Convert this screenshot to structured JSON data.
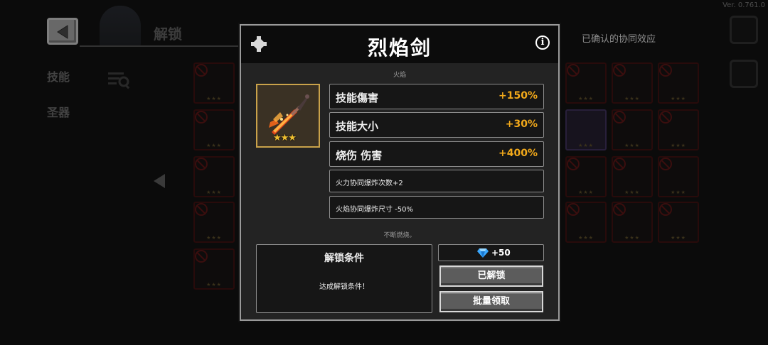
{
  "version": "Ver. 0.761.0",
  "screen": {
    "title": "解锁",
    "side_tabs": [
      "技能",
      "圣器"
    ],
    "synergy_label": "已确认的协同效应"
  },
  "modal": {
    "title": "烈焰剑",
    "subtitle": "火焰",
    "item_stars": "★★★",
    "stats": [
      {
        "name": "技能傷害",
        "value": "+150%"
      },
      {
        "name": "技能大小",
        "value": "+30%"
      },
      {
        "name": "烧伤 伤害",
        "value": "+400%"
      }
    ],
    "effects": [
      "火力协同爆炸次数+2",
      "火焰协同爆炸尺寸 -50%"
    ],
    "description": "不断燃烧。",
    "unlock": {
      "heading": "解锁条件",
      "condition": "达成解锁条件！"
    },
    "reward": {
      "amount": "+50"
    },
    "buttons": {
      "unlocked": "已解锁",
      "batch_claim": "批量领取"
    }
  },
  "colors": {
    "stat_value": "#f2a91a",
    "frame_gold": "#c9a24a",
    "gem": "#3aa8ff"
  }
}
